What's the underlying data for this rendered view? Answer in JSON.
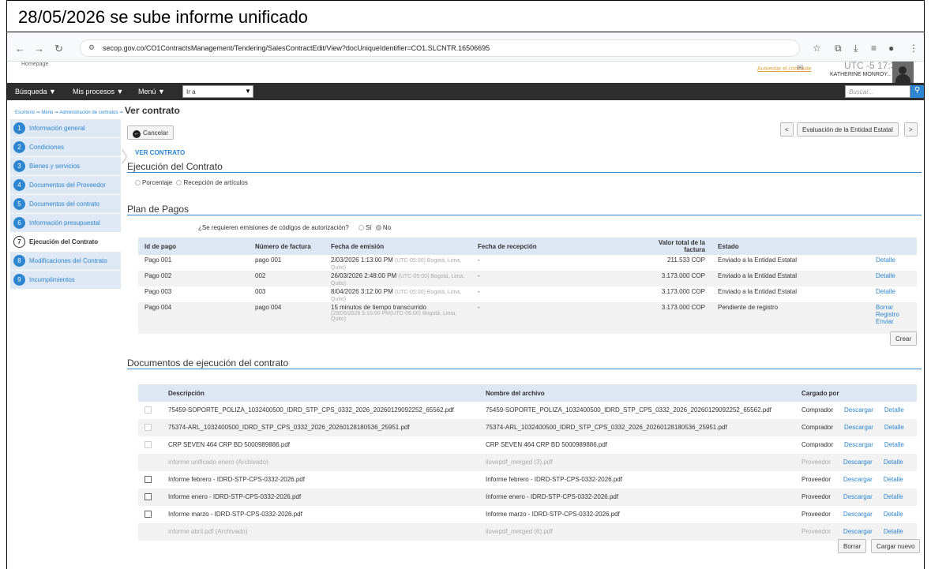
{
  "caption": "28/05/2026 se sube informe unificado",
  "browser": {
    "url": "secop.gov.co/CO1ContractsManagement/Tendering/SalesContractEdit/View?docUniqueIdentifier=CO1.SLCNTR.16506695"
  },
  "site": {
    "logo_alt": "Homepage",
    "aumentar": "Aumentar el contraste",
    "clock": "UTC -5 17:30:54",
    "user": "KATHERINE MONROY..."
  },
  "menu": {
    "busqueda": "Búsqueda ▼",
    "mis_procesos": "Mis procesos ▼",
    "menu": "Menú ▼",
    "ira": "Ir a",
    "search_placeholder": "Buscar..."
  },
  "breadcrumb": {
    "path": "Escritorio ➞ Menú ➞ Administración de contratos ➞ ",
    "current": "Ver contrato"
  },
  "sidebar": {
    "items": [
      {
        "num": "1",
        "label": "Información general"
      },
      {
        "num": "2",
        "label": "Condiciones"
      },
      {
        "num": "3",
        "label": "Bienes y servicios"
      },
      {
        "num": "4",
        "label": "Documentos del Proveedor"
      },
      {
        "num": "5",
        "label": "Documentos del contrato"
      },
      {
        "num": "6",
        "label": "Información presupuestal"
      },
      {
        "num": "7",
        "label": "Ejecución del Contrato"
      },
      {
        "num": "8",
        "label": "Modificaciones del Contrato"
      },
      {
        "num": "9",
        "label": "Incumplimientos"
      }
    ]
  },
  "toolbar": {
    "cancel": "Cancelar",
    "prev": "<",
    "next": ">",
    "evaluacion": "Evaluación de la Entidad Estatal"
  },
  "step_label": "VER CONTRATO",
  "ejecucion": {
    "title": "Ejecución del Contrato",
    "opt1": "Porcentaje",
    "opt2": "Recepción de artículos"
  },
  "plan": {
    "title": "Plan de Pagos",
    "question": "¿Se requieren emisiones de códigos de autorización?",
    "si": "Sí",
    "no": "No",
    "headers": [
      "Id de pago",
      "Número de factura",
      "Fecha de emisión",
      "Fecha de recepción",
      "Valor total de la factura",
      "Estado"
    ],
    "rows": [
      {
        "id": "Pago 001",
        "factura": "pago 001",
        "fecha": "2/03/2026 1:13:00 PM",
        "tz": "(UTC-05:00) Bogotá, Lima, Quito)",
        "recepcion": "-",
        "valor": "211.533 COP",
        "estado": "Enviado a la Entidad Estatal",
        "action": "Detalle"
      },
      {
        "id": "Pago 002",
        "factura": "002",
        "fecha": "26/03/2026 2:48:00 PM",
        "tz": "(UTC-05:00) Bogotá, Lima, Quito)",
        "recepcion": "-",
        "valor": "3.173.000 COP",
        "estado": "Enviado a la Entidad Estatal",
        "action": "Detalle"
      },
      {
        "id": "Pago 003",
        "factura": "003",
        "fecha": "8/04/2026 3:12:00 PM",
        "tz": "(UTC-05:00) Bogotá, Lima, Quito)",
        "recepcion": "-",
        "valor": "3.173.000 COP",
        "estado": "Enviado a la Entidad Estatal",
        "action": "Detalle"
      },
      {
        "id": "Pago 004",
        "factura": "pago 004",
        "fecha": "15 minutos de tiempo transcurrido",
        "tz": "(28/05/2026 5:15:00 PM(UTC-05:00) Bogotá, Lima, Quito)",
        "recepcion": "-",
        "valor": "3.173.000 COP",
        "estado": "Pendiente de registro",
        "a1": "Borrar",
        "a2": "Registro",
        "a3": "Enviar"
      }
    ],
    "crear": "Crear"
  },
  "docs": {
    "title": "Documentos de ejecución del contrato",
    "headers": [
      "Descripción",
      "Nombre del archivo",
      "Cargado por"
    ],
    "rows": [
      {
        "desc": "75459-SOPORTE_POLIZA_1032400500_IDRD_STP_CPS_0332_2026_20260129092252_65562.pdf",
        "file": "75459-SOPORTE_POLIZA_1032400500_IDRD_STP_CPS_0332_2026_20260129092252_65562.pdf",
        "by": "Comprador",
        "d1": "Descargar",
        "d2": "Detalle"
      },
      {
        "desc": "75374-ARL_1032400500_IDRD_STP_CPS_0332_2026_20260128180536_25951.pdf",
        "file": "75374-ARL_1032400500_IDRD_STP_CPS_0332_2026_20260128180536_25951.pdf",
        "by": "Comprador",
        "d1": "Descargar",
        "d2": "Detalle"
      },
      {
        "desc": "CRP SEVEN 464 CRP BD 5000989886.pdf",
        "file": "CRP SEVEN 464 CRP BD 5000989886.pdf",
        "by": "Comprador",
        "d1": "Descargar",
        "d2": "Detalle"
      },
      {
        "desc": "informe unificado enero (Archivado)",
        "file": "ilovepdf_merged (3).pdf",
        "by": "Proveedor",
        "d1": "Descargar",
        "d2": "Detalle"
      },
      {
        "desc": "Informe febrero - IDRD-STP-CPS-0332-2026.pdf",
        "file": "Informe febrero - IDRD-STP-CPS-0332-2026.pdf",
        "by": "Proveedor",
        "d1": "Descargar",
        "d2": "Detalle"
      },
      {
        "desc": "Informe enero - IDRD-STP-CPS-0332-2026.pdf",
        "file": "Informe enero - IDRD-STP-CPS-0332-2026.pdf",
        "by": "Proveedor",
        "d1": "Descargar",
        "d2": "Detalle"
      },
      {
        "desc": "Informe marzo - IDRD-STP-CPS-0332-2026.pdf",
        "file": "Informe marzo - IDRD-STP-CPS-0332-2026.pdf",
        "by": "Proveedor",
        "d1": "Descargar",
        "d2": "Detalle"
      },
      {
        "desc": "informe abril.pdf (Archivado)",
        "file": "ilovepdf_merged (6).pdf",
        "by": "Proveedor",
        "d1": "Descargar",
        "d2": "Detalle"
      }
    ],
    "borrar": "Borrar",
    "cargar": "Cargar nuevo"
  }
}
